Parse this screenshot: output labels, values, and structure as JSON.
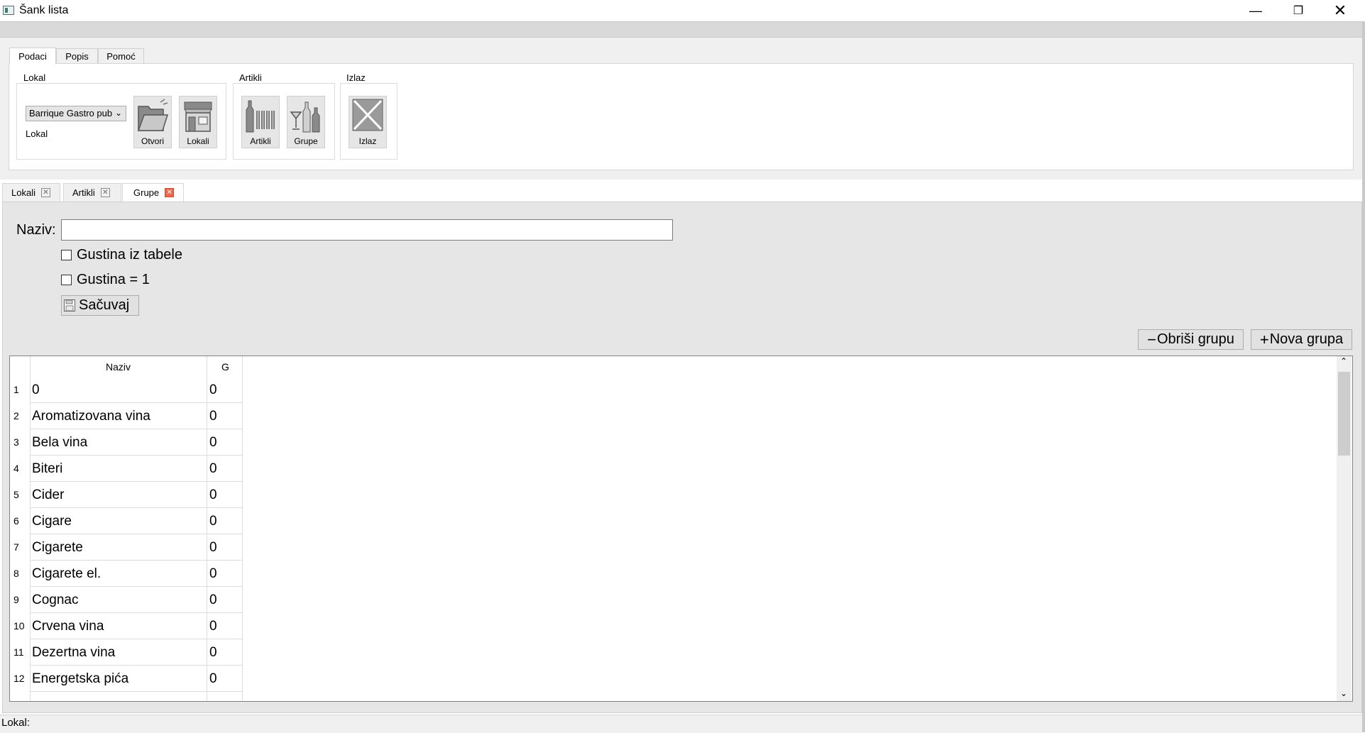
{
  "window": {
    "title": "Šank lista"
  },
  "ribbon": {
    "tabs": [
      "Podaci",
      "Popis",
      "Pomoć"
    ],
    "groups": {
      "lokal": {
        "title": "Lokal",
        "select_value": "Barrique Gastro pub",
        "field_label": "Lokal",
        "btn_open": "Otvori",
        "btn_lokali": "Lokali"
      },
      "artikli": {
        "title": "Artikli",
        "btn_artikli": "Artikli",
        "btn_grupe": "Grupe"
      },
      "izlaz": {
        "title": "Izlaz",
        "btn_izlaz": "Izlaz"
      }
    }
  },
  "doc_tabs": [
    "Lokali",
    "Artikli",
    "Grupe"
  ],
  "form": {
    "naziv_label": "Naziv:",
    "naziv_value": "",
    "chk1_label": "Gustina iz tabele",
    "chk2_label": "Gustina = 1",
    "save_label": "Sačuvaj"
  },
  "actions": {
    "delete_label": "Obriši grupu",
    "new_label": "Nova grupa"
  },
  "table": {
    "headers": [
      "Naziv",
      "G"
    ],
    "rows": [
      {
        "n": "1",
        "naziv": "0",
        "g": "0"
      },
      {
        "n": "2",
        "naziv": "Aromatizovana vina",
        "g": "0"
      },
      {
        "n": "3",
        "naziv": "Bela vina",
        "g": "0"
      },
      {
        "n": "4",
        "naziv": "Biteri",
        "g": "0"
      },
      {
        "n": "5",
        "naziv": "Cider",
        "g": "0"
      },
      {
        "n": "6",
        "naziv": "Cigare",
        "g": "0"
      },
      {
        "n": "7",
        "naziv": "Cigarete",
        "g": "0"
      },
      {
        "n": "8",
        "naziv": "Cigarete el.",
        "g": "0"
      },
      {
        "n": "9",
        "naziv": "Cognac",
        "g": "0"
      },
      {
        "n": "10",
        "naziv": "Crvena vina",
        "g": "0"
      },
      {
        "n": "11",
        "naziv": "Dezertna vina",
        "g": "0"
      },
      {
        "n": "12",
        "naziv": "Energetska pića",
        "g": "0"
      }
    ]
  },
  "status": {
    "text": "Lokal:"
  }
}
